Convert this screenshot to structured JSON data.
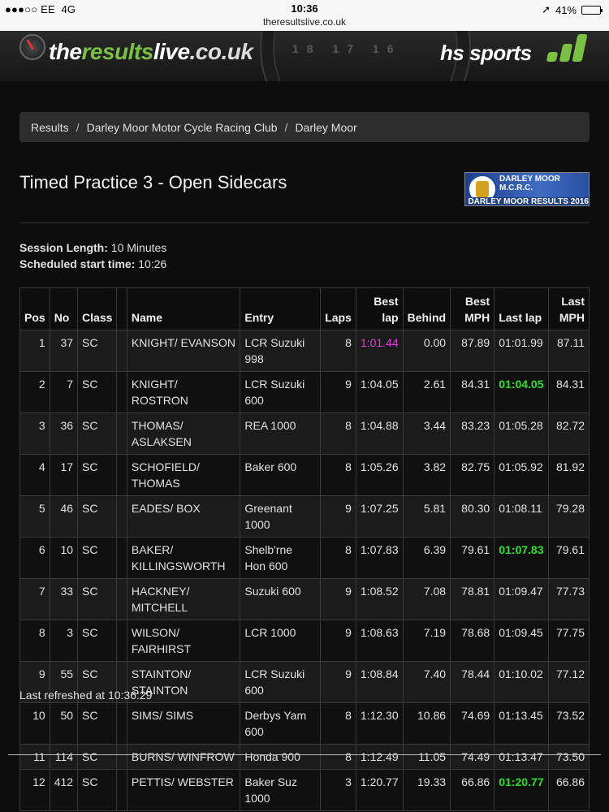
{
  "status_bar": {
    "carrier": "●●●○○ EE",
    "network": "4G",
    "time": "10:36",
    "url": "theresultslive.co.uk",
    "location_icon": "location-arrow-icon",
    "battery": "41%",
    "battery_level": 0.41
  },
  "banner": {
    "logo_part1": "the",
    "logo_part2": "results",
    "logo_part3": "live",
    "logo_tld": ".co.uk",
    "sponsor": "hs sports",
    "dial_numbers": "18 17 16",
    "colors": {
      "accent_green": "#7ac143"
    }
  },
  "breadcrumb": {
    "items": [
      "Results",
      "Darley Moor Motor Cycle Racing Club",
      "Darley Moor"
    ],
    "separator": "/"
  },
  "page": {
    "title": "Timed Practice 3 - Open Sidecars",
    "club_logo_top": "DARLEY MOOR M.C.R.C.",
    "club_logo_bottom": "DARLEY MOOR RESULTS 2016"
  },
  "session": {
    "length_label": "Session Length:",
    "length_value": "10 Minutes",
    "start_label": "Scheduled start time:",
    "start_value": "10:26"
  },
  "table": {
    "headers": {
      "pos": "Pos",
      "no": "No",
      "class": "Class",
      "name": "Name",
      "entry": "Entry",
      "laps": "Laps",
      "best_lap_1": "Best",
      "best_lap_2": "lap",
      "behind": "Behind",
      "best_mph_1": "Best",
      "best_mph_2": "MPH",
      "last_lap": "Last lap",
      "last_mph_1": "Last",
      "last_mph_2": "MPH"
    },
    "rows": [
      {
        "pos": "1",
        "no": "37",
        "class": "SC",
        "name": "KNIGHT/ EVANSON",
        "entry": "LCR Suzuki 998",
        "laps": "8",
        "best_lap": "1:01.44",
        "behind": "0.00",
        "best_mph": "87.89",
        "last_lap": "01:01.99",
        "last_mph": "87.11",
        "best_hl": "purple",
        "last_hl": ""
      },
      {
        "pos": "2",
        "no": "7",
        "class": "SC",
        "name": "KNIGHT/ ROSTRON",
        "entry": "LCR Suzuki 600",
        "laps": "9",
        "best_lap": "1:04.05",
        "behind": "2.61",
        "best_mph": "84.31",
        "last_lap": "01:04.05",
        "last_mph": "84.31",
        "best_hl": "",
        "last_hl": "green"
      },
      {
        "pos": "3",
        "no": "36",
        "class": "SC",
        "name": "THOMAS/ ASLAKSEN",
        "entry": "REA 1000",
        "laps": "8",
        "best_lap": "1:04.88",
        "behind": "3.44",
        "best_mph": "83.23",
        "last_lap": "01:05.28",
        "last_mph": "82.72",
        "best_hl": "",
        "last_hl": ""
      },
      {
        "pos": "4",
        "no": "17",
        "class": "SC",
        "name": "SCHOFIELD/ THOMAS",
        "entry": "Baker 600",
        "laps": "8",
        "best_lap": "1:05.26",
        "behind": "3.82",
        "best_mph": "82.75",
        "last_lap": "01:05.92",
        "last_mph": "81.92",
        "best_hl": "",
        "last_hl": ""
      },
      {
        "pos": "5",
        "no": "46",
        "class": "SC",
        "name": "EADES/ BOX",
        "entry": "Greenant 1000",
        "laps": "9",
        "best_lap": "1:07.25",
        "behind": "5.81",
        "best_mph": "80.30",
        "last_lap": "01:08.11",
        "last_mph": "79.28",
        "best_hl": "",
        "last_hl": ""
      },
      {
        "pos": "6",
        "no": "10",
        "class": "SC",
        "name": "BAKER/ KILLINGSWORTH",
        "entry": "Shelb'rne Hon 600",
        "laps": "8",
        "best_lap": "1:07.83",
        "behind": "6.39",
        "best_mph": "79.61",
        "last_lap": "01:07.83",
        "last_mph": "79.61",
        "best_hl": "",
        "last_hl": "green"
      },
      {
        "pos": "7",
        "no": "33",
        "class": "SC",
        "name": "HACKNEY/ MITCHELL",
        "entry": "Suzuki 600",
        "laps": "9",
        "best_lap": "1:08.52",
        "behind": "7.08",
        "best_mph": "78.81",
        "last_lap": "01:09.47",
        "last_mph": "77.73",
        "best_hl": "",
        "last_hl": ""
      },
      {
        "pos": "8",
        "no": "3",
        "class": "SC",
        "name": "WILSON/ FAIRHIRST",
        "entry": "LCR 1000",
        "laps": "9",
        "best_lap": "1:08.63",
        "behind": "7.19",
        "best_mph": "78.68",
        "last_lap": "01:09.45",
        "last_mph": "77.75",
        "best_hl": "",
        "last_hl": ""
      },
      {
        "pos": "9",
        "no": "55",
        "class": "SC",
        "name": "STAINTON/ STAINTON",
        "entry": "LCR Suzuki 600",
        "laps": "9",
        "best_lap": "1:08.84",
        "behind": "7.40",
        "best_mph": "78.44",
        "last_lap": "01:10.02",
        "last_mph": "77.12",
        "best_hl": "",
        "last_hl": ""
      },
      {
        "pos": "10",
        "no": "50",
        "class": "SC",
        "name": "SIMS/ SIMS",
        "entry": "Derbys Yam 600",
        "laps": "8",
        "best_lap": "1:12.30",
        "behind": "10.86",
        "best_mph": "74.69",
        "last_lap": "01:13.45",
        "last_mph": "73.52",
        "best_hl": "",
        "last_hl": ""
      },
      {
        "pos": "11",
        "no": "114",
        "class": "SC",
        "name": "BURNS/ WINFROW",
        "entry": "Honda 900",
        "laps": "8",
        "best_lap": "1:12.49",
        "behind": "11.05",
        "best_mph": "74.49",
        "last_lap": "01:13.47",
        "last_mph": "73.50",
        "best_hl": "",
        "last_hl": ""
      },
      {
        "pos": "12",
        "no": "412",
        "class": "SC",
        "name": "PETTIS/ WEBSTER",
        "entry": "Baker Suz 1000",
        "laps": "3",
        "best_lap": "1:20.77",
        "behind": "19.33",
        "best_mph": "66.86",
        "last_lap": "01:20.77",
        "last_mph": "66.86",
        "best_hl": "",
        "last_hl": "green"
      }
    ]
  },
  "footer": {
    "refreshed": "Last refreshed at 10:36:29"
  }
}
